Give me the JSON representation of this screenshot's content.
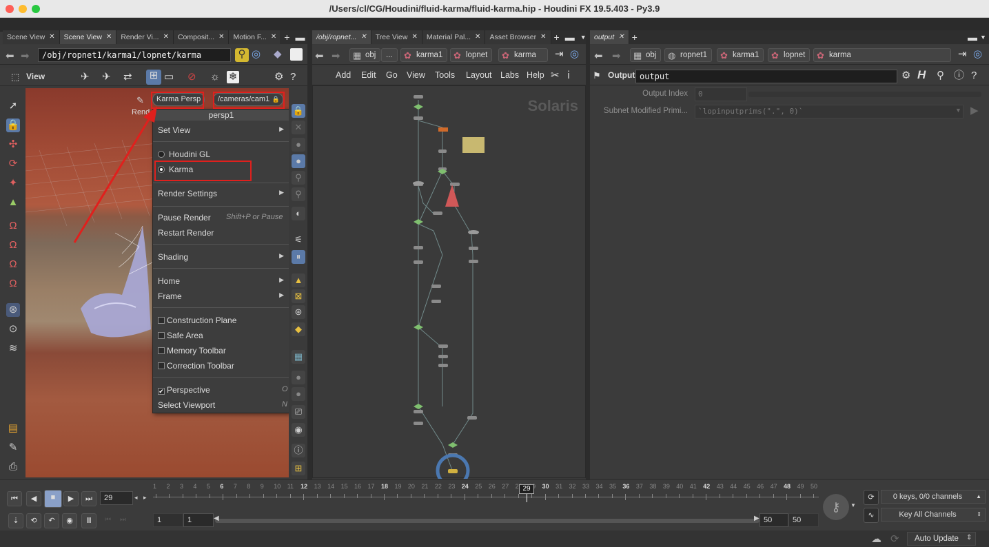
{
  "window": {
    "title": "/Users/cl/CG/Houdini/fluid-karma/fluid-karma.hip - Houdini FX 19.5.403 - Py3.9"
  },
  "left_pane": {
    "tabs": [
      "Scene View",
      "Scene View",
      "Render Vi...",
      "Composit...",
      "Motion F..."
    ],
    "path": "/obj/ropnet1/karma1/lopnet/karma",
    "toolbar_label": "View",
    "camera_button": "Karma  Persp",
    "camera_path": "/cameras/cam1",
    "render_label": "Rend"
  },
  "context_menu": {
    "header": "persp1",
    "items": {
      "set_view": "Set View",
      "houdini_gl": "Houdini GL",
      "karma": "Karma",
      "render_settings": "Render Settings",
      "pause_render": "Pause Render",
      "pause_shortcut": "Shift+P or Pause",
      "restart_render": "Restart Render",
      "shading": "Shading",
      "home": "Home",
      "frame": "Frame",
      "construction_plane": "Construction Plane",
      "safe_area": "Safe Area",
      "memory_toolbar": "Memory Toolbar",
      "correction_toolbar": "Correction Toolbar",
      "perspective": "Perspective",
      "perspective_shortcut": "O",
      "select_viewport": "Select Viewport",
      "select_viewport_shortcut": "N"
    },
    "selected_renderer": "Karma"
  },
  "mid_pane": {
    "tabs": [
      "/obj/ropnet...",
      "Tree View",
      "Material Pal...",
      "Asset Browser"
    ],
    "crumbs": [
      "obj",
      "...",
      "karma1",
      "lopnet",
      "karma"
    ],
    "menu": [
      "Add",
      "Edit",
      "Go",
      "View",
      "Tools",
      "Layout",
      "Labs",
      "Help"
    ],
    "watermark": "Solaris"
  },
  "right_pane": {
    "tab": "output",
    "crumbs": [
      "obj",
      "ropnet1",
      "karma1",
      "lopnet",
      "karma"
    ],
    "node_type": "Output",
    "node_name": "output",
    "params": {
      "output_index_label": "Output Index",
      "output_index_value": "0",
      "subnet_label": "Subnet Modified Primi...",
      "subnet_value": "`lopinputprims(\".\", 0)`"
    }
  },
  "timeline": {
    "current_frame": "29",
    "range_start": "1",
    "range_start2": "1",
    "range_end": "50",
    "range_end2": "50",
    "ticks": [
      "1",
      "2",
      "3",
      "4",
      "5",
      "6",
      "7",
      "8",
      "9",
      "10",
      "11",
      "12",
      "13",
      "14",
      "15",
      "16",
      "17",
      "18",
      "19",
      "20",
      "21",
      "22",
      "23",
      "24",
      "25",
      "26",
      "27",
      "28",
      "29",
      "30",
      "31",
      "32",
      "33",
      "34",
      "35",
      "36",
      "37",
      "38",
      "39",
      "40",
      "41",
      "42",
      "43",
      "44",
      "45",
      "46",
      "47",
      "48",
      "49",
      "50"
    ],
    "bold_ticks": [
      "6",
      "12",
      "18",
      "24",
      "30",
      "36",
      "42",
      "48"
    ],
    "keys_label": "0 keys, 0/0 channels",
    "key_all": "Key All Channels"
  },
  "status": {
    "auto_update": "Auto Update"
  },
  "colors": {
    "annotation_red": "#e0201d",
    "node_green": "#7fbf6f"
  }
}
